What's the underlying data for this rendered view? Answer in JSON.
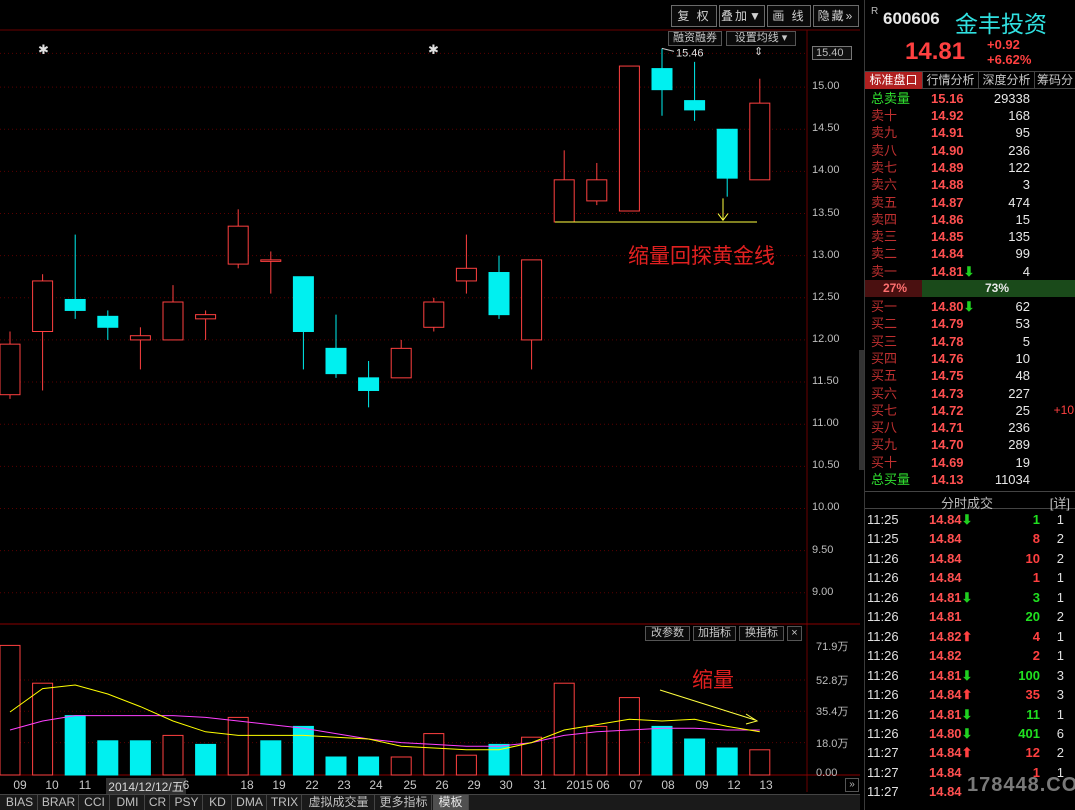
{
  "toolbar": {
    "restore_label": "复 权",
    "overlay_label": "叠加▼",
    "draw_label": "画 线",
    "hide_label": "隐藏»",
    "margin_label": "融资融券",
    "ma_label": "设置均线 ▾"
  },
  "chart_data": {
    "type": "candlestick",
    "x": [
      "09",
      "10",
      "11",
      "12",
      "15",
      "16",
      "17",
      "18",
      "19",
      "22",
      "23",
      "24",
      "25",
      "26",
      "29",
      "30",
      "31",
      "2015 06",
      "07",
      "08",
      "09",
      "12",
      "13"
    ],
    "date_labels": [
      "09",
      "10",
      "11",
      "2014/12/12/五",
      "6",
      "18",
      "19",
      "22",
      "23",
      "24",
      "25",
      "26",
      "29",
      "30",
      "31",
      "2015 06",
      "07",
      "08",
      "09",
      "12",
      "13"
    ],
    "date_labels_positions_comment": "",
    "ohlc": [
      [
        11.35,
        11.95,
        12.1,
        11.3
      ],
      [
        12.1,
        12.7,
        12.78,
        11.4
      ],
      [
        12.48,
        12.35,
        13.25,
        12.25
      ],
      [
        12.28,
        12.15,
        12.35,
        12.0
      ],
      [
        12.0,
        12.05,
        12.15,
        11.65
      ],
      [
        12.0,
        12.45,
        12.65,
        12.0
      ],
      [
        12.25,
        12.3,
        12.35,
        12.0
      ],
      [
        12.9,
        13.35,
        13.55,
        12.85
      ],
      [
        12.95,
        12.95,
        13.05,
        12.55
      ],
      [
        12.75,
        12.1,
        12.75,
        11.65
      ],
      [
        11.9,
        11.6,
        12.3,
        11.55
      ],
      [
        11.55,
        11.4,
        11.75,
        11.2
      ],
      [
        11.55,
        11.9,
        12.0,
        11.55
      ],
      [
        12.15,
        12.45,
        12.5,
        12.1
      ],
      [
        12.7,
        12.85,
        13.25,
        12.55
      ],
      [
        12.8,
        12.3,
        13.0,
        12.25
      ],
      [
        12.0,
        12.95,
        12.95,
        11.65
      ],
      [
        13.4,
        13.9,
        14.25,
        13.4
      ],
      [
        13.65,
        13.9,
        14.1,
        13.6
      ],
      [
        13.53,
        15.25,
        15.25,
        13.53
      ],
      [
        15.22,
        14.97,
        15.46,
        14.66
      ],
      [
        14.84,
        14.73,
        15.3,
        14.6
      ],
      [
        14.5,
        13.92,
        14.5,
        13.7
      ],
      [
        13.9,
        14.81,
        15.1,
        13.9
      ]
    ],
    "ylim": [
      8.7,
      15.5
    ],
    "yticks": [
      "15.40",
      "15.00",
      "14.50",
      "14.00",
      "13.50",
      "13.00",
      "12.50",
      "12.00",
      "11.50",
      "11.00",
      "10.50",
      "10.00",
      "9.50",
      "9.00"
    ],
    "high_marker": "15.46",
    "annotation_main": "缩量回探黄金线",
    "annotation_volume": "缩量",
    "volume_ticks": [
      "71.9万",
      "52.8万",
      "35.4万",
      "18.0万",
      "0.00"
    ],
    "volume": [
      72,
      51,
      33,
      19,
      19,
      22,
      17,
      32,
      19,
      27,
      10,
      10,
      10,
      23,
      11,
      17,
      21,
      51,
      27,
      43,
      27,
      20,
      15,
      14
    ],
    "volume_up": [
      true,
      true,
      false,
      false,
      false,
      true,
      false,
      true,
      false,
      false,
      false,
      false,
      true,
      true,
      true,
      false,
      true,
      true,
      true,
      true,
      false,
      false,
      false,
      true
    ],
    "volume_ylim": [
      0,
      75
    ],
    "ma5": [
      35,
      48,
      50,
      45,
      38,
      30,
      24,
      22,
      22,
      22,
      21,
      20,
      16,
      15,
      14,
      14,
      18,
      25,
      28,
      31,
      30,
      31,
      27,
      24
    ],
    "ma10": [
      25,
      30,
      33,
      33,
      33,
      33,
      32,
      30,
      28,
      26,
      23,
      20,
      18,
      17,
      16,
      16,
      18,
      22,
      24,
      25,
      26,
      26,
      25,
      25
    ],
    "colors": {
      "up": "#ff4040",
      "down": "#00f0f0",
      "ma5": "#ffff00",
      "ma10": "#ff40ff",
      "grid": "#5a0000"
    }
  },
  "indicator_btns": {
    "params": "改参数",
    "add": "加指标",
    "swap": "换指标",
    "close": "×"
  },
  "bottom_tabs": [
    "BIAS",
    "BRAR",
    "CCI",
    "DMI",
    "CR",
    "PSY",
    "KD",
    "DMA",
    "TRIX",
    "虚拟成交量",
    "更多指标",
    "模板"
  ],
  "stock": {
    "code": "600606",
    "name": "金丰投资",
    "price": "14.81",
    "change": "+0.92",
    "change_pct": "+6.62%",
    "r_mark": "R"
  },
  "side_tabs": [
    "标准盘口",
    "行情分析",
    "深度分析",
    "筹码分"
  ],
  "orderbook": {
    "total_sell": {
      "label": "总卖量",
      "price": "15.16",
      "qty": "29338"
    },
    "sells": [
      {
        "label": "卖十",
        "price": "14.92",
        "qty": "168"
      },
      {
        "label": "卖九",
        "price": "14.91",
        "qty": "95"
      },
      {
        "label": "卖八",
        "price": "14.90",
        "qty": "236"
      },
      {
        "label": "卖七",
        "price": "14.89",
        "qty": "122"
      },
      {
        "label": "卖六",
        "price": "14.88",
        "qty": "3"
      },
      {
        "label": "卖五",
        "price": "14.87",
        "qty": "474"
      },
      {
        "label": "卖四",
        "price": "14.86",
        "qty": "15"
      },
      {
        "label": "卖三",
        "price": "14.85",
        "qty": "135"
      },
      {
        "label": "卖二",
        "price": "14.84",
        "qty": "99"
      },
      {
        "label": "卖一",
        "price": "14.81",
        "qty": "4",
        "arrow": "⬇"
      }
    ],
    "ratio_left": "27%",
    "ratio_right": "73%",
    "ratio_value": 0.27,
    "buys": [
      {
        "label": "买一",
        "price": "14.80",
        "qty": "62",
        "arrow": "⬇"
      },
      {
        "label": "买二",
        "price": "14.79",
        "qty": "53"
      },
      {
        "label": "买三",
        "price": "14.78",
        "qty": "5"
      },
      {
        "label": "买四",
        "price": "14.76",
        "qty": "10"
      },
      {
        "label": "买五",
        "price": "14.75",
        "qty": "48"
      },
      {
        "label": "买六",
        "price": "14.73",
        "qty": "227"
      },
      {
        "label": "买七",
        "price": "14.72",
        "qty": "25",
        "chg": "+10"
      },
      {
        "label": "买八",
        "price": "14.71",
        "qty": "236"
      },
      {
        "label": "买九",
        "price": "14.70",
        "qty": "289"
      },
      {
        "label": "买十",
        "price": "14.69",
        "qty": "19"
      }
    ],
    "total_buy": {
      "label": "总买量",
      "price": "14.13",
      "qty": "11034"
    }
  },
  "ticks_header": {
    "title": "分时成交",
    "detail": "[详]"
  },
  "ticks": [
    {
      "t": "11:25",
      "p": "14.84",
      "a": "⬇",
      "v": "1",
      "n": "1",
      "dir": "down"
    },
    {
      "t": "11:25",
      "p": "14.84",
      "a": "",
      "v": "8",
      "n": "2",
      "dir": "up"
    },
    {
      "t": "11:26",
      "p": "14.84",
      "a": "",
      "v": "10",
      "n": "2",
      "dir": "up"
    },
    {
      "t": "11:26",
      "p": "14.84",
      "a": "",
      "v": "1",
      "n": "1",
      "dir": "up"
    },
    {
      "t": "11:26",
      "p": "14.81",
      "a": "⬇",
      "v": "3",
      "n": "1",
      "dir": "down"
    },
    {
      "t": "11:26",
      "p": "14.81",
      "a": "",
      "v": "20",
      "n": "2",
      "dir": "down"
    },
    {
      "t": "11:26",
      "p": "14.82",
      "a": "⬆",
      "v": "4",
      "n": "1",
      "dir": "up"
    },
    {
      "t": "11:26",
      "p": "14.82",
      "a": "",
      "v": "2",
      "n": "1",
      "dir": "up"
    },
    {
      "t": "11:26",
      "p": "14.81",
      "a": "⬇",
      "v": "100",
      "n": "3",
      "dir": "down"
    },
    {
      "t": "11:26",
      "p": "14.84",
      "a": "⬆",
      "v": "35",
      "n": "3",
      "dir": "up"
    },
    {
      "t": "11:26",
      "p": "14.81",
      "a": "⬇",
      "v": "11",
      "n": "1",
      "dir": "down"
    },
    {
      "t": "11:26",
      "p": "14.80",
      "a": "⬇",
      "v": "401",
      "n": "6",
      "dir": "down"
    },
    {
      "t": "11:27",
      "p": "14.84",
      "a": "⬆",
      "v": "12",
      "n": "2",
      "dir": "up"
    },
    {
      "t": "11:27",
      "p": "14.84",
      "a": "",
      "v": "1",
      "n": "1",
      "dir": "up"
    },
    {
      "t": "11:27",
      "p": "14.84",
      "a": "",
      "v": "",
      "n": "",
      "dir": "up"
    }
  ],
  "watermark": "178448.COM"
}
